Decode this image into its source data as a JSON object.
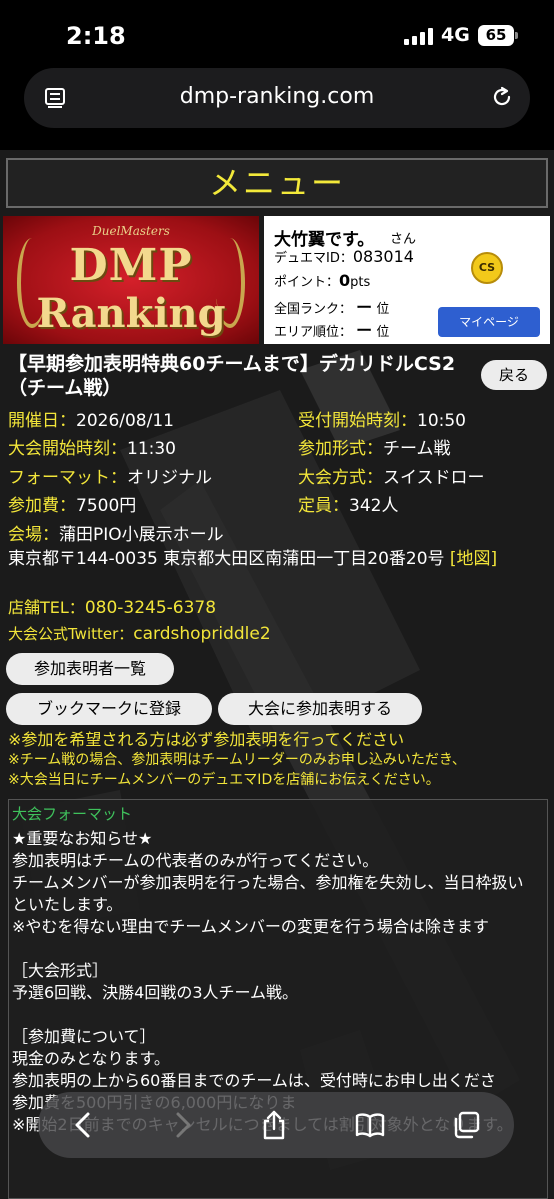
{
  "status_bar": {
    "time": "2:18",
    "network": "4G",
    "battery": "65"
  },
  "browser": {
    "url": "dmp-ranking.com"
  },
  "header": {
    "menu_label": "メニュー"
  },
  "logo": {
    "top_text": "DuelMasters",
    "line1": "DMP",
    "line2": "Ranking"
  },
  "profile": {
    "name": "大竹翼です。",
    "honorific": "さん",
    "duema_id_label": "デュエマID：",
    "duema_id": "083014",
    "points_label": "ポイント：",
    "points_value": "0",
    "points_unit": "pts",
    "national_rank_label": "全国ランク：",
    "national_rank_value": "ー",
    "national_rank_unit": "位",
    "area_rank_label": "エリア順位：",
    "area_rank_value": "ー",
    "area_rank_unit": "位",
    "cs_badge": "CS",
    "mypage_button": "マイページ"
  },
  "event": {
    "title": "【早期参加表明特典60チームまで】デカリドルCS2（チーム戦）",
    "back_button": "戻る",
    "date_label": "開催日：",
    "date_value": "2026/08/11",
    "reception_label": "受付開始時刻：",
    "reception_value": "10:50",
    "start_label": "大会開始時刻：",
    "start_value": "11:30",
    "entry_format_label": "参加形式：",
    "entry_format_value": "チーム戦",
    "format_label": "フォーマット：",
    "format_value": "オリジナル",
    "system_label": "大会方式：",
    "system_value": "スイスドロー",
    "fee_label": "参加費：",
    "fee_value": "7500円",
    "capacity_label": "定員：",
    "capacity_value": "342人",
    "venue_label": "会場：",
    "venue_value": "蒲田PIO小展示ホール",
    "address": "東京都〒144-0035 東京都大田区南蒲田一丁目20番20号 ",
    "map_link": "[地図]",
    "tel_label": "店舗TEL：",
    "tel_value": "080-3245-6378",
    "twitter_label": "大会公式Twitter：",
    "twitter_value": "cardshopriddle2"
  },
  "buttons": {
    "participants": "参加表明者一覧",
    "bookmark": "ブックマークに登録",
    "join": "大会に参加表明する"
  },
  "notes": [
    "※参加を希望される方は必ず参加表明を行ってください",
    "※チーム戦の場合、参加表明はチームリーダーのみお申し込みいただき、",
    "※大会当日にチームメンバーのデュエマIDを店舗にお伝えください。"
  ],
  "format_box": {
    "heading": "大会フォーマット",
    "body": "★重要なお知らせ★\n参加表明はチームの代表者のみが行ってください。\nチームメンバーが参加表明を行った場合、参加権を失効し、当日枠扱いといたします。\n※やむを得ない理由でチームメンバーの変更を行う場合は除きます\n\n［大会形式］\n予選6回戦、決勝4回戦の3人チーム戦。\n\n［参加費について］\n現金のみとなります。\n参加表明の上から60番目までのチームは、受付時にお申し出くださ\n参加費を500円引きの6,000円になりま\n※開始2日前までのキャンセルにつきましては割引対象外となります。"
  },
  "toolbar": {
    "back": "back-icon",
    "forward": "forward-icon",
    "share": "share-icon",
    "bookmarks": "book-icon",
    "tabs": "tabs-icon"
  }
}
